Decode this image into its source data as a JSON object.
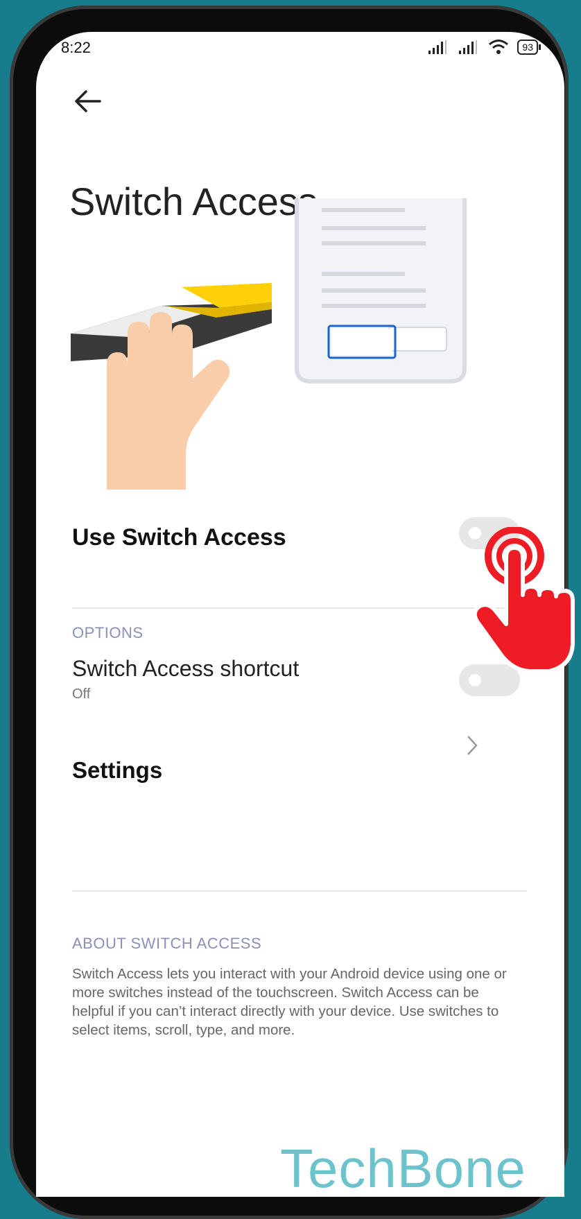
{
  "status_bar": {
    "time": "8:22",
    "battery": "93"
  },
  "header": {
    "title": "Switch Access"
  },
  "main": {
    "use_switch_access": {
      "label": "Use Switch Access",
      "enabled": false
    },
    "options": {
      "header": "OPTIONS",
      "shortcut": {
        "label": "Switch Access shortcut",
        "status": "Off",
        "enabled": false
      },
      "settings": {
        "label": "Settings"
      }
    },
    "about": {
      "header": "ABOUT SWITCH ACCESS",
      "text": "Switch Access lets you interact with your Android device using one or more switches instead of the touchscreen. Switch Access can be helpful if you can’t interact directly with your device. Use switches to select items, scroll, type, and more."
    }
  },
  "watermark": "TechBone",
  "colors": {
    "background": "#177d8c",
    "accent_red": "#ee1c24",
    "section_header": "#8a90b8",
    "switch_yellow": "#fdd00a",
    "selection_blue": "#1a66c9"
  },
  "icons": [
    "back-arrow-icon",
    "signal-icon",
    "wifi-icon",
    "battery-icon",
    "chevron-right-icon",
    "tap-hand-icon"
  ]
}
